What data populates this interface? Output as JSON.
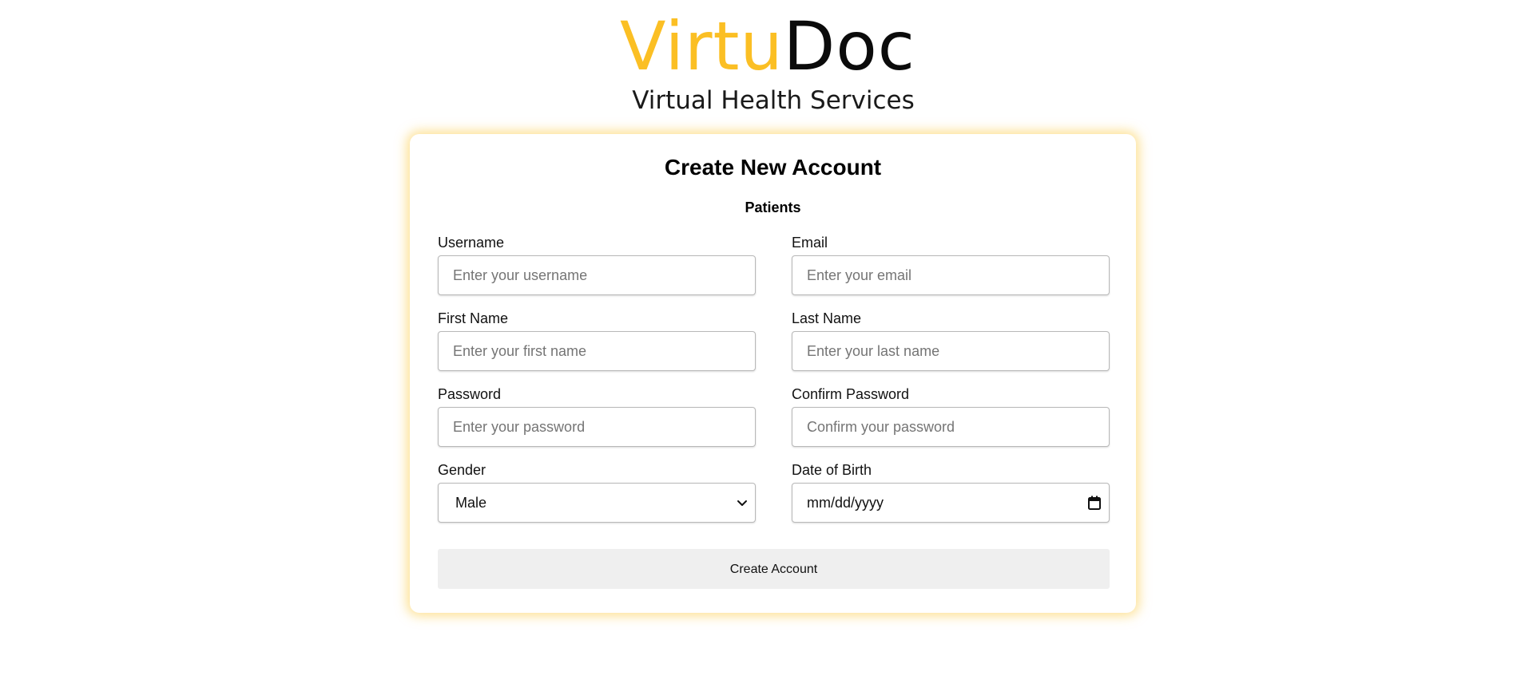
{
  "brand": {
    "logo_part1": "Virtu",
    "logo_part2": "Doc",
    "tagline": "Virtual Health Services",
    "accent_color": "#fbbf24"
  },
  "form": {
    "title": "Create New Account",
    "subtitle": "Patients",
    "fields": {
      "username": {
        "label": "Username",
        "placeholder": "Enter your username",
        "value": ""
      },
      "email": {
        "label": "Email",
        "placeholder": "Enter your email",
        "value": ""
      },
      "first_name": {
        "label": "First Name",
        "placeholder": "Enter your first name",
        "value": ""
      },
      "last_name": {
        "label": "Last Name",
        "placeholder": "Enter your last name",
        "value": ""
      },
      "password": {
        "label": "Password",
        "placeholder": "Enter your password",
        "value": ""
      },
      "confirm_password": {
        "label": "Confirm Password",
        "placeholder": "Confirm your password",
        "value": ""
      },
      "gender": {
        "label": "Gender",
        "selected": "Male",
        "icon": "chevron-down-icon"
      },
      "dob": {
        "label": "Date of Birth",
        "value": "mm/dd/yyyy",
        "icon": "calendar-icon"
      }
    },
    "submit_label": "Create Account"
  }
}
